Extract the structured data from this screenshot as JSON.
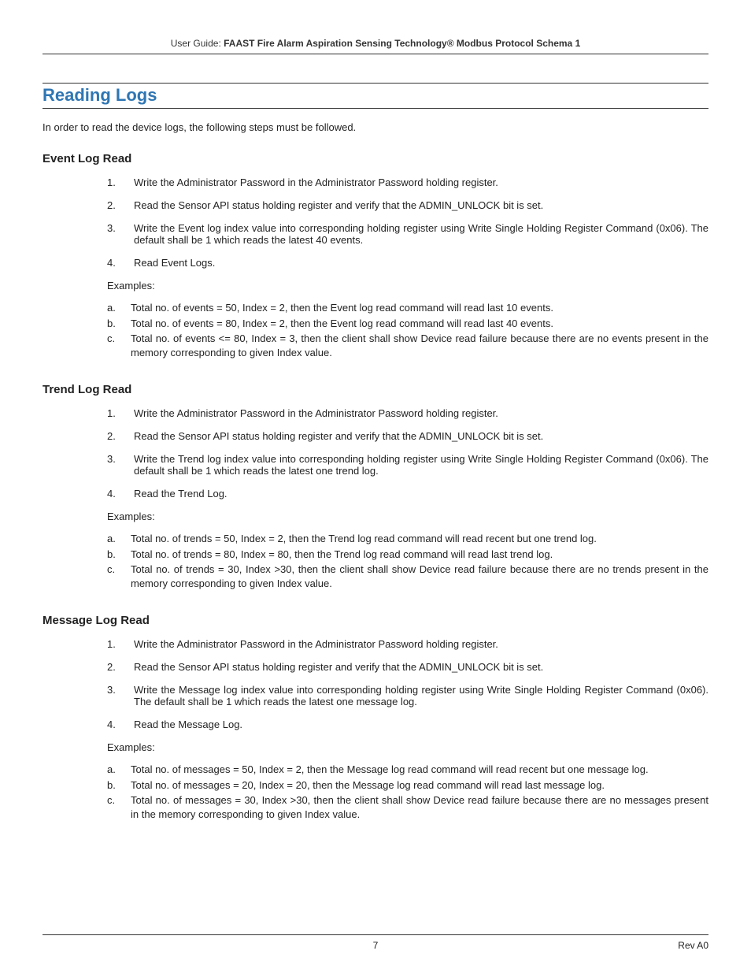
{
  "header": {
    "prefix": "User Guide: ",
    "title": "FAAST Fire Alarm Aspiration Sensing Technology® Modbus Protocol Schema 1"
  },
  "section_title": "Reading Logs",
  "intro": "In order to read the device logs, the following steps must be followed.",
  "subsections": [
    {
      "title": "Event Log Read",
      "steps": [
        "Write the Administrator Password in the Administrator Password holding register.",
        "Read the Sensor API status holding register and verify that the ADMIN_UNLOCK bit is set.",
        "Write the Event log index value into corresponding holding register using Write Single Holding Register Command (0x06). The default shall be 1 which reads the latest 40 events.",
        "Read Event Logs."
      ],
      "examples_label": "Examples:",
      "examples": [
        "Total no. of events = 50, Index = 2, then the Event log read command will read last 10 events.",
        "Total no. of events = 80, Index = 2, then the Event log read command will read last 40 events.",
        "Total no. of events <= 80, Index = 3, then the client shall show Device read failure because there are no events present in the memory corresponding to given Index value."
      ]
    },
    {
      "title": "Trend Log Read",
      "steps": [
        "Write the Administrator Password in the Administrator Password holding register.",
        "Read the Sensor API status holding register and verify that the ADMIN_UNLOCK bit is set.",
        "Write the Trend log index value into corresponding holding register using Write Single Holding Register Command (0x06). The default shall be 1 which reads the latest one trend log.",
        "Read the Trend Log."
      ],
      "examples_label": "Examples:",
      "examples": [
        "Total no. of trends = 50, Index = 2, then the Trend log read command will read recent but one trend log.",
        "Total no. of trends = 80, Index = 80, then the Trend log read command will read last trend log.",
        "Total no. of trends = 30, Index >30, then the client shall show Device read failure because there are no trends present in the memory corresponding to given Index value."
      ]
    },
    {
      "title": "Message Log Read",
      "steps": [
        "Write the Administrator Password in the Administrator Password holding register.",
        "Read the Sensor API status holding register and verify that the ADMIN_UNLOCK bit is set.",
        "Write the Message log index value into corresponding holding register using Write Single Holding Register Command (0x06). The default shall be 1 which reads the latest one message log.",
        "Read the Message Log."
      ],
      "examples_label": "Examples:",
      "examples": [
        "Total no. of messages = 50, Index = 2, then the Message log read command will read recent but one message log.",
        "Total no. of messages = 20, Index = 20, then the Message log read command will read last message log.",
        "Total no. of messages = 30, Index >30, then the client shall show Device read failure because there are no messages present in the memory corresponding to given Index value."
      ]
    }
  ],
  "footer": {
    "page": "7",
    "rev": "Rev A0"
  }
}
